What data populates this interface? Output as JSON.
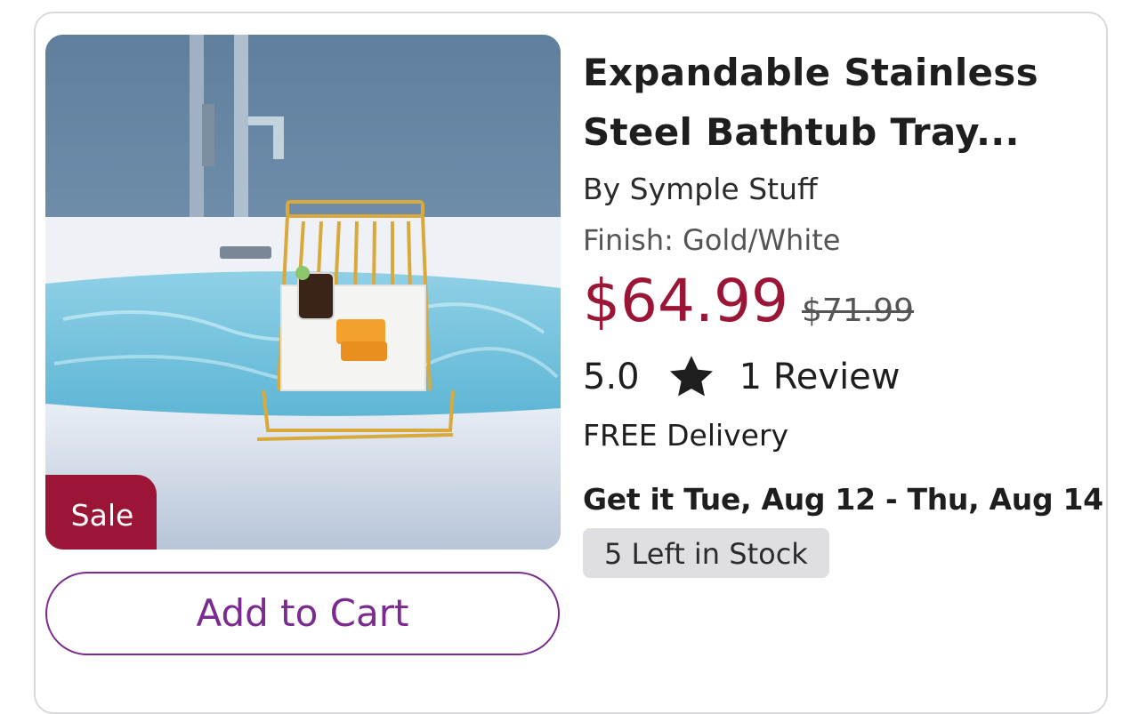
{
  "product": {
    "title": "Expandable Stainless Steel Bathtub Tray...",
    "brand": "By Symple Stuff",
    "finish": "Finish: Gold/White",
    "price": "$64.99",
    "original_price": "$71.99",
    "badge": "Sale",
    "image_alt": "Gold bathtub tray with drink and soap over a filled bathtub"
  },
  "rating": {
    "score": "5.0",
    "icon": "star-icon",
    "reviews": "1 Review"
  },
  "shipping": {
    "delivery": "FREE Delivery",
    "eta": "Get it Tue, Aug 12 - Thu, Aug 14",
    "stock": "5 Left in Stock"
  },
  "actions": {
    "add_to_cart": "Add to Cart"
  },
  "colors": {
    "sale_price": "#9b1536",
    "sale_badge": "#9b1536",
    "cart_button": "#7b2a8f",
    "stock_pill": "#dfdfe3"
  }
}
